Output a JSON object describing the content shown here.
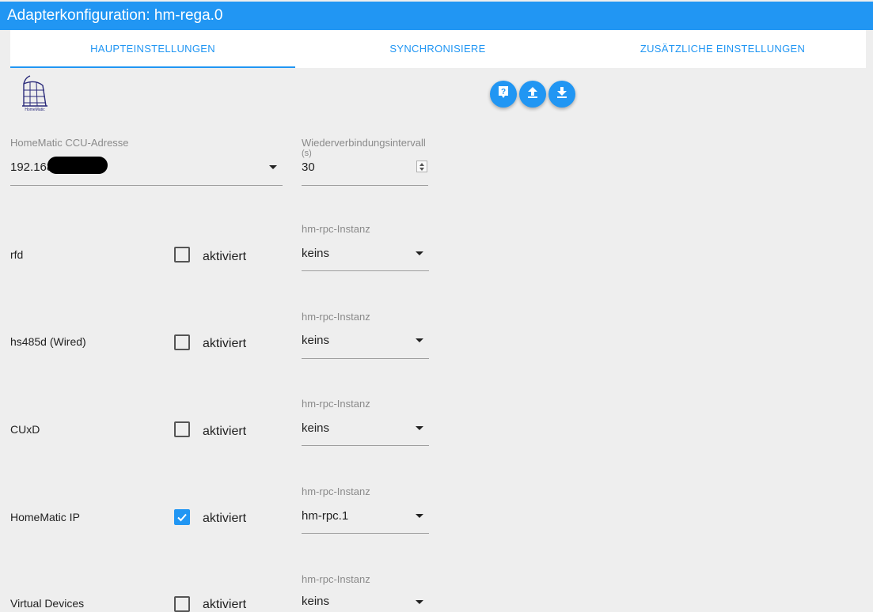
{
  "window": {
    "title": "Adapterkonfiguration: hm-rega.0"
  },
  "tabs": [
    {
      "label": "HAUPTEINSTELLUNGEN",
      "active": true
    },
    {
      "label": "SYNCHRONISIERE",
      "active": false
    },
    {
      "label": "ZUSÄTZLICHE EINSTELLUNGEN",
      "active": false
    }
  ],
  "logo": {
    "text": "HomeMatic"
  },
  "actions": [
    {
      "icon": "help-icon"
    },
    {
      "icon": "upload-icon"
    },
    {
      "icon": "download-icon"
    }
  ],
  "ccu": {
    "label": "HomeMatic CCU-Adresse",
    "value": "192.168"
  },
  "reconnect": {
    "label_line1": "Wiederverbindungsintervall",
    "label_line2": "(s)",
    "value": "30"
  },
  "checkbox_label": "aktiviert",
  "instance_label": "hm-rpc-Instanz",
  "rows": [
    {
      "name": "rfd",
      "checked": false,
      "instance": "keins"
    },
    {
      "name": "hs485d (Wired)",
      "checked": false,
      "instance": "keins"
    },
    {
      "name": "CUxD",
      "checked": false,
      "instance": "keins"
    },
    {
      "name": "HomeMatic IP",
      "checked": true,
      "instance": "hm-rpc.1"
    },
    {
      "name": "Virtual Devices",
      "checked": false,
      "instance": "keins"
    }
  ],
  "colors": {
    "accent": "#2196f3",
    "background": "#eeeeee"
  }
}
